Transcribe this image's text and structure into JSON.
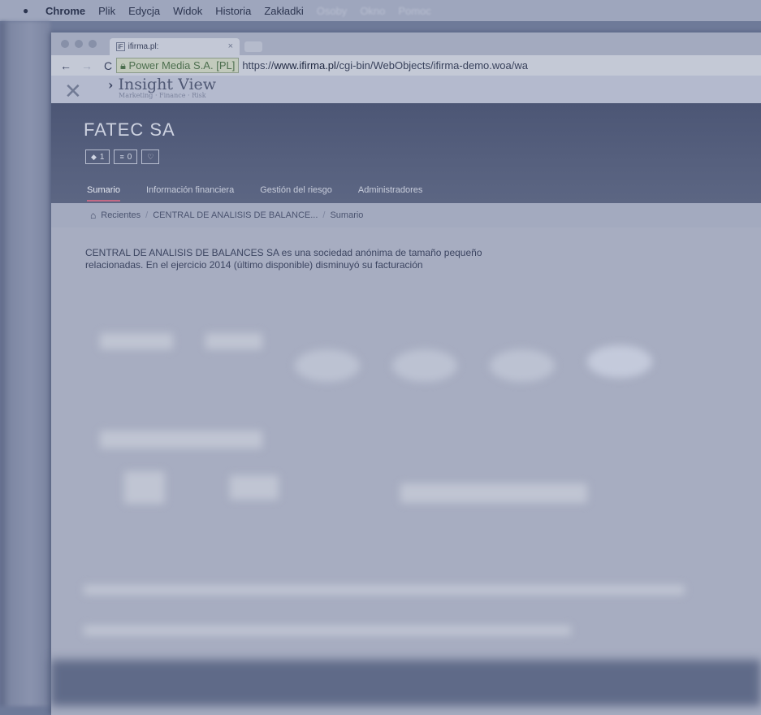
{
  "menubar": {
    "app": "Chrome",
    "items": [
      "Plik",
      "Edycja",
      "Widok",
      "Historia",
      "Zakładki",
      "Osoby",
      "Okno",
      "Pomoc"
    ]
  },
  "browser": {
    "tab_title": "ifirma.pl:",
    "tab_favicon": "iF",
    "secure_label": "Power Media S.A. [PL]",
    "url_prefix": "https://",
    "url_host": "www.ifirma.pl",
    "url_path": "/cgi-bin/WebObjects/ifirma-demo.woa/wa"
  },
  "site": {
    "logo_title": "Insight View",
    "logo_subtitle": "Marketing · Finance · Risk",
    "company_name": "FATEC SA",
    "badges": [
      {
        "icon": "tag-icon",
        "value": "1"
      },
      {
        "icon": "list-icon",
        "value": "0"
      },
      {
        "icon": "heart-icon",
        "value": ""
      }
    ],
    "tabs": [
      "Sumario",
      "Información financiera",
      "Gestión del riesgo",
      "Administradores"
    ],
    "active_tab": "Sumario",
    "breadcrumb": [
      "Recientes",
      "CENTRAL DE ANALISIS DE BALANCE...",
      "Sumario"
    ],
    "description_line1": "CENTRAL DE ANALISIS DE BALANCES SA es una sociedad anónima de tamaño pequeño",
    "description_line2": "relacionadas. En el ejercicio 2014 (último disponible) disminuyó su facturación"
  },
  "colors": {
    "hero": "#4c5675",
    "active_tab_underline": "#c46a86",
    "overlay_tint": "#6e7a99"
  }
}
